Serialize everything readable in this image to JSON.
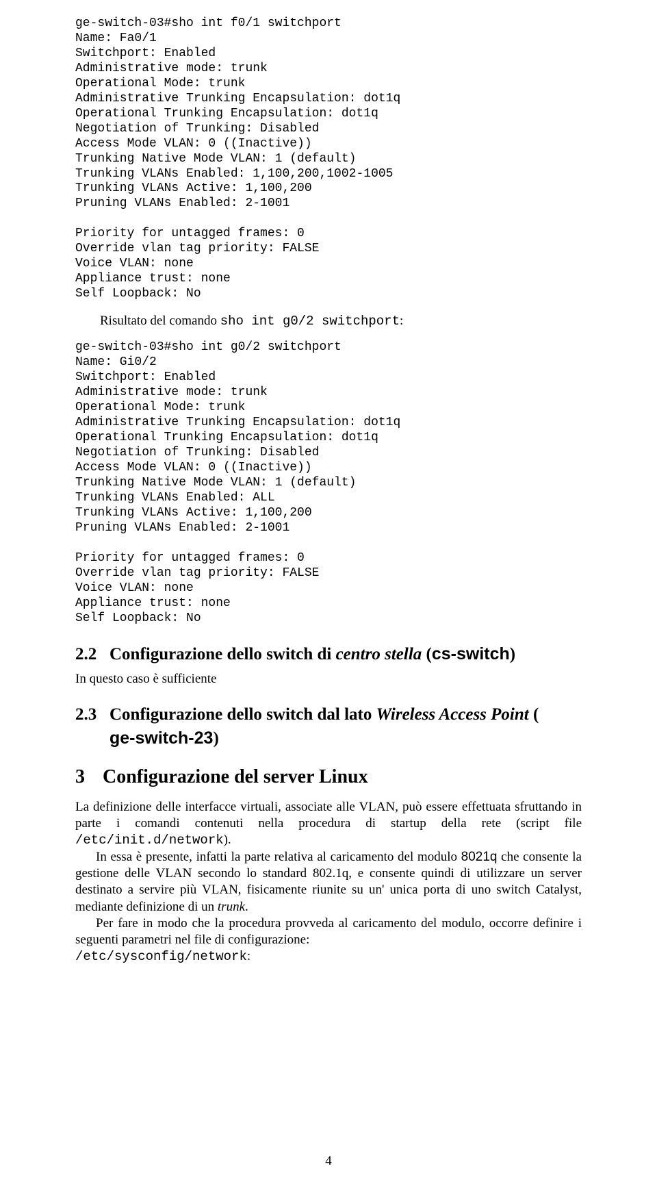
{
  "code1": "ge-switch-03#sho int f0/1 switchport\nName: Fa0/1\nSwitchport: Enabled\nAdministrative mode: trunk\nOperational Mode: trunk\nAdministrative Trunking Encapsulation: dot1q\nOperational Trunking Encapsulation: dot1q\nNegotiation of Trunking: Disabled\nAccess Mode VLAN: 0 ((Inactive))\nTrunking Native Mode VLAN: 1 (default)\nTrunking VLANs Enabled: 1,100,200,1002-1005\nTrunking VLANs Active: 1,100,200\nPruning VLANs Enabled: 2-1001\n\nPriority for untagged frames: 0\nOverride vlan tag priority: FALSE\nVoice VLAN: none\nAppliance trust: none\nSelf Loopback: No",
  "line1a": "Risultato del comando ",
  "line1b": "sho int g0/2 switchport",
  "line1c": ":",
  "code2": "ge-switch-03#sho int g0/2 switchport\nName: Gi0/2\nSwitchport: Enabled\nAdministrative mode: trunk\nOperational Mode: trunk\nAdministrative Trunking Encapsulation: dot1q\nOperational Trunking Encapsulation: dot1q\nNegotiation of Trunking: Disabled\nAccess Mode VLAN: 0 ((Inactive))\nTrunking Native Mode VLAN: 1 (default)\nTrunking VLANs Enabled: ALL\nTrunking VLANs Active: 1,100,200\nPruning VLANs Enabled: 2-1001\n\nPriority for untagged frames: 0\nOverride vlan tag priority: FALSE\nVoice VLAN: none\nAppliance trust: none\nSelf Loopback: No",
  "sec22": {
    "num": "2.2",
    "t1": "Configurazione dello switch di ",
    "t2": "centro stella",
    "t3": " (",
    "t4": "cs-switch",
    "t5": ")"
  },
  "p22": "In questo caso è sufficiente",
  "sec23": {
    "num": "2.3",
    "t1": "Configurazione dello switch dal lato ",
    "t2": "Wireless Access Point",
    "t3": " (",
    "t4": "ge-switch-23",
    "t5": ")"
  },
  "sec3": {
    "num": "3",
    "t1": "Configurazione del server Linux"
  },
  "p3a_1": "La definizione delle interfacce virtuali, associate alle VLAN, può essere effettuata sfruttando in parte i comandi contenuti nella procedura di startup della rete (script file ",
  "p3a_2": "/etc/init.d/network",
  "p3a_3": ").",
  "p3b_1": "In essa è presente, infatti la parte relativa al caricamento del modulo ",
  "p3b_2": "8021q",
  "p3b_3": " che consente la gestione delle VLAN secondo lo standard 802.1q, e consente quindi di utilizzare un server destinato a servire più VLAN, fisicamente riunite su un' unica porta di uno switch Catalyst, mediante definizione di un ",
  "p3b_4": "trunk",
  "p3b_5": ".",
  "p3c": "Per fare in modo che la procedura provveda al caricamento del modulo, occorre definire i seguenti parametri nel file di configurazione:",
  "p3d": "/etc/sysconfig/network",
  "p3d2": ":",
  "pagenum": "4"
}
